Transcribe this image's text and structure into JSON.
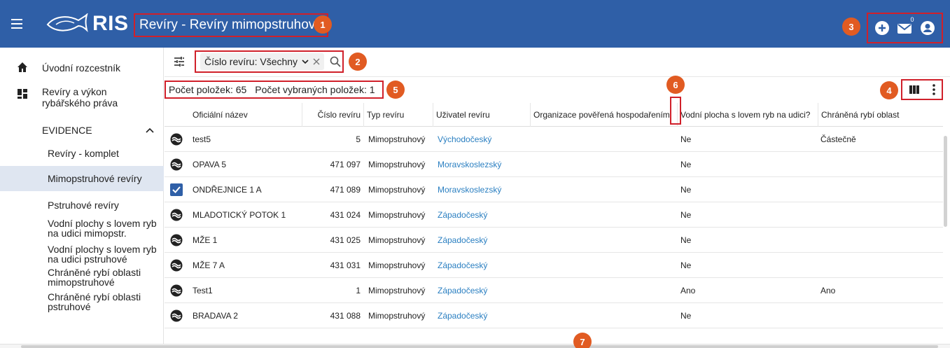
{
  "header": {
    "logo_text": "RIS",
    "title": "Revíry - Revíry mimopstruhové",
    "mail_count": "0",
    "bg_color": "#2f5fa7"
  },
  "annotations": [
    "1",
    "2",
    "3",
    "4",
    "5",
    "6",
    "7"
  ],
  "sidebar": {
    "home": "Úvodní rozcestník",
    "rights": "Revíry a výkon rybářského práva",
    "evidence": "EVIDENCE",
    "items": [
      "Revíry - komplet",
      "Mimopstruhové revíry",
      "Pstruhové revíry",
      "Vodní plochy s lovem ryb na udici mimopstr.",
      "Vodní plochy s lovem ryb na udici pstruhové",
      "Chráněné rybí oblasti mimopstruhové",
      "Chráněné rybí oblasti pstruhové"
    ]
  },
  "filter": {
    "chip_label": "Číslo revíru: Všechny"
  },
  "counts": {
    "total": "Počet položek: 65",
    "selected": "Počet vybraných položek: 1"
  },
  "table": {
    "columns": [
      "Oficiální název",
      "Číslo revíru",
      "Typ revíru",
      "Uživatel revíru",
      "Organizace pověřená hospodařením",
      "Vodní plocha s lovem ryb na udici?",
      "Chráněná rybí oblast"
    ],
    "rows": [
      {
        "name": "test5",
        "number": "5",
        "type": "Mimopstruhový",
        "user": "Východočeský",
        "org": "",
        "water": "Ne",
        "protected": "Částečně",
        "checked": false
      },
      {
        "name": "OPAVA 5",
        "number": "471 097",
        "type": "Mimopstruhový",
        "user": "Moravskoslezský",
        "org": "",
        "water": "Ne",
        "protected": "",
        "checked": false
      },
      {
        "name": "ONDŘEJNICE 1 A",
        "number": "471 089",
        "type": "Mimopstruhový",
        "user": "Moravskoslezský",
        "org": "",
        "water": "Ne",
        "protected": "",
        "checked": true
      },
      {
        "name": "MLADOTICKÝ POTOK 1",
        "number": "431 024",
        "type": "Mimopstruhový",
        "user": "Západočeský",
        "org": "",
        "water": "Ne",
        "protected": "",
        "checked": false
      },
      {
        "name": "MŽE 1",
        "number": "431 025",
        "type": "Mimopstruhový",
        "user": "Západočeský",
        "org": "",
        "water": "Ne",
        "protected": "",
        "checked": false
      },
      {
        "name": "MŽE 7 A",
        "number": "431 031",
        "type": "Mimopstruhový",
        "user": "Západočeský",
        "org": "",
        "water": "Ne",
        "protected": "",
        "checked": false
      },
      {
        "name": "Test1",
        "number": "1",
        "type": "Mimopstruhový",
        "user": "Západočeský",
        "org": "",
        "water": "Ano",
        "protected": "Ano",
        "checked": false
      },
      {
        "name": "BRADAVA 2",
        "number": "431 088",
        "type": "Mimopstruhový",
        "user": "Západočeský",
        "org": "",
        "water": "Ne",
        "protected": "",
        "checked": false
      }
    ]
  }
}
